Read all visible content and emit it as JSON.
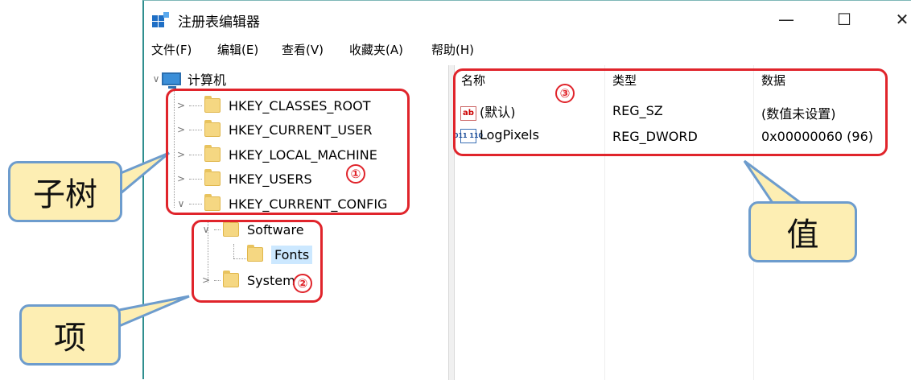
{
  "window": {
    "title": "注册表编辑器",
    "controls": {
      "minimize": "—",
      "maximize": "☐",
      "close": "✕"
    }
  },
  "menu": [
    "文件(F)",
    "编辑(E)",
    "查看(V)",
    "收藏夹(A)",
    "帮助(H)"
  ],
  "tree": {
    "root": "计算机",
    "hives": [
      "HKEY_CLASSES_ROOT",
      "HKEY_CURRENT_USER",
      "HKEY_LOCAL_MACHINE",
      "HKEY_USERS",
      "HKEY_CURRENT_CONFIG"
    ],
    "subkeys": [
      "Software",
      "Fonts",
      "System"
    ],
    "selected": "Fonts"
  },
  "list": {
    "columns": [
      "名称",
      "类型",
      "数据"
    ],
    "rows": [
      {
        "name": "(默认)",
        "type": "REG_SZ",
        "data": "(数值未设置)",
        "icon": "ab"
      },
      {
        "name": "LogPixels",
        "type": "REG_DWORD",
        "data": "0x00000060 (96)",
        "icon": "011 110"
      }
    ]
  },
  "annotations": {
    "numbers": [
      "①",
      "②",
      "③"
    ],
    "callouts": {
      "subtree": "子树",
      "key": "项",
      "value": "值"
    },
    "accent_color": "#e0242b",
    "callout_fill": "#fdeeb3",
    "callout_border": "#6d9ccd"
  }
}
